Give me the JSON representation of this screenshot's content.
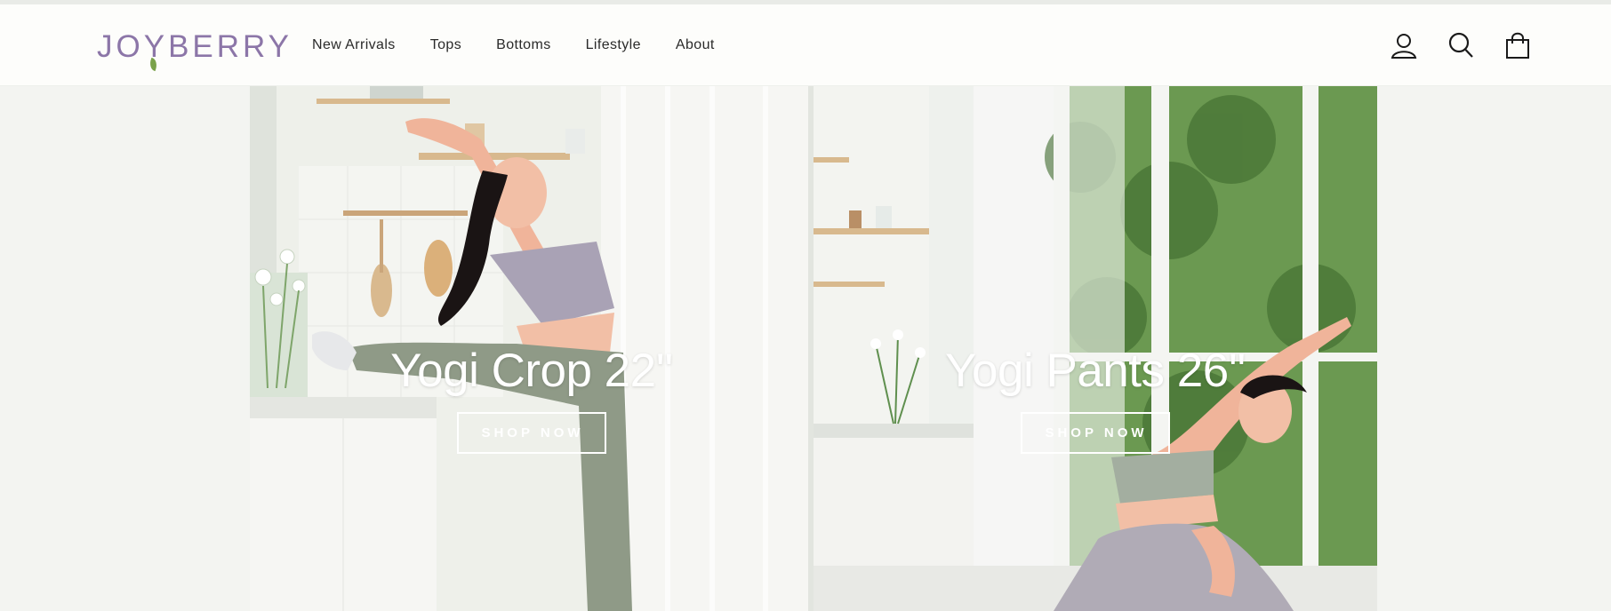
{
  "brand": {
    "name_pre": "JOY",
    "name_post": "BERRY",
    "color": "#8c76a8",
    "leaf_color": "#7aa24a"
  },
  "nav": [
    {
      "label": "New Arrivals"
    },
    {
      "label": "Tops"
    },
    {
      "label": "Bottoms"
    },
    {
      "label": "Lifestyle"
    },
    {
      "label": "About"
    }
  ],
  "header_icons": [
    "account-icon",
    "search-icon",
    "cart-icon"
  ],
  "hero": [
    {
      "title": "Yogi Crop 22''",
      "cta": "SHOP NOW"
    },
    {
      "title": "Yogi Pants 26''",
      "cta": "SHOP NOW"
    }
  ]
}
